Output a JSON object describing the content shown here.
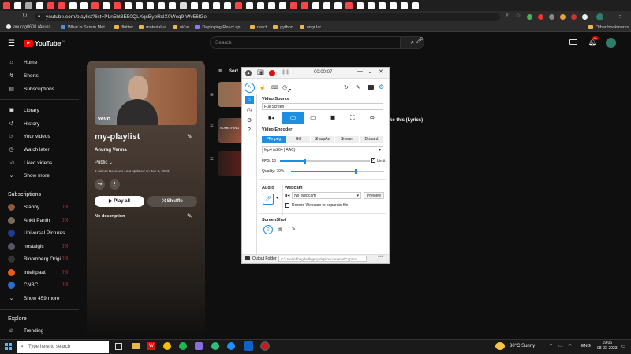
{
  "browser": {
    "url": "youtube.com/playlist?list=PLn5ht8E50QLXqsBypRxlX0Wcq9-Wv56lGe",
    "tab_colors": [
      "#ff4444",
      "#ffffff",
      "#aaaaaa",
      "#ffffff",
      "#ff4444",
      "#ff4444",
      "#ffffff",
      "#ffffff",
      "#ff4444",
      "#ffffff",
      "#ff4444",
      "#ffffff",
      "#ffffff",
      "#ffffff",
      "#ffffff",
      "#ffffff",
      "#dddddd",
      "#ffffff",
      "#ffffff",
      "#ffffff",
      "#ffffff",
      "#ff4444",
      "#ffffff",
      "#ffffff",
      "#ffffff",
      "#ffffff",
      "#ff4444",
      "#ff4444",
      "#ffffff",
      "#ffffff",
      "#ffffff",
      "#ff4444",
      "#ffffff",
      "#ffffff",
      "#ffffff",
      "#ffffff",
      "#ffffff",
      "#ffffff"
    ],
    "bookmarks": [
      "anurag0608 (Anura...",
      "What Is Scrum Met...",
      "flutter",
      "material-ui",
      "ui/ux",
      "Deploying React ap...",
      "react",
      "python",
      "angular"
    ],
    "other_bookmarks": "Other bookmarks"
  },
  "youtube": {
    "logo": "YouTube",
    "logo_sup": "IN",
    "search_placeholder": "Search",
    "notification_badge": "9+",
    "sidebar": {
      "main": [
        "Home",
        "Shorts",
        "Subscriptions"
      ],
      "you": [
        "Library",
        "History",
        "Your videos",
        "Watch later",
        "Liked videos",
        "Show more"
      ],
      "subscriptions_title": "Subscriptions",
      "subscriptions": [
        {
          "name": "Stabby",
          "color": "#8a5a3c"
        },
        {
          "name": "Ankit Panth",
          "color": "#7a6a5a"
        },
        {
          "name": "Universal Pictures",
          "color": "#1d3c8f"
        },
        {
          "name": "nostalgic",
          "color": "#556"
        },
        {
          "name": "Bloomberg Origi...",
          "color": "#222"
        },
        {
          "name": "Intellipaat",
          "color": "#e85a1a"
        },
        {
          "name": "CNBC",
          "color": "#2a6bd6"
        }
      ],
      "show_more_subs": "Show 459 more",
      "explore_title": "Explore",
      "trending": "Trending",
      "live_label": "((•))"
    },
    "playlist": {
      "vevo": "vevo",
      "title": "my-playlist",
      "owner": "Anurag Verma",
      "privacy": "Public",
      "stats": "3 videos  No views  Last updated on Jan 5, 2023",
      "play_all": "Play all",
      "shuffle": "Shuffle",
      "description": "No description"
    },
    "sort_label": "Sort",
    "video_title_partial": "ke this (Lyrics)"
  },
  "sharex": {
    "timer": "00:00:07",
    "video_source_label": "Video Source",
    "video_source_value": "Full Screen",
    "video_encoder_label": "Video Encoder",
    "encoder_tabs": [
      "FFmpeg",
      "Gif",
      "SharpAvi",
      "Stream",
      "Discard"
    ],
    "codec": "Mp4 (x264 | AAC)",
    "fps_label": "FPS:",
    "fps_value": "10",
    "fps_fraction": 0.28,
    "limit_label": "Limit",
    "quality_label": "Quality:",
    "quality_value": "70%",
    "quality_fraction": 0.7,
    "audio_label": "Audio",
    "webcam_label": "Webcam",
    "webcam_value": "No Webcam",
    "preview_label": "Preview",
    "record_webcam_label": "Record Webcam to separate file",
    "screenshot_label": "ScreenShot",
    "output_folder_label": "Output Folder",
    "output_folder_path": "C:\\Users\\hhegdsdkgpspidsp\\Documents\\Captura",
    "accent": "#1e8fe0"
  },
  "taskbar": {
    "search_placeholder": "Type here to search",
    "weather": "30°C  Sunny",
    "lang": "ENG",
    "time": "19:06",
    "date": "08-02-2023"
  }
}
